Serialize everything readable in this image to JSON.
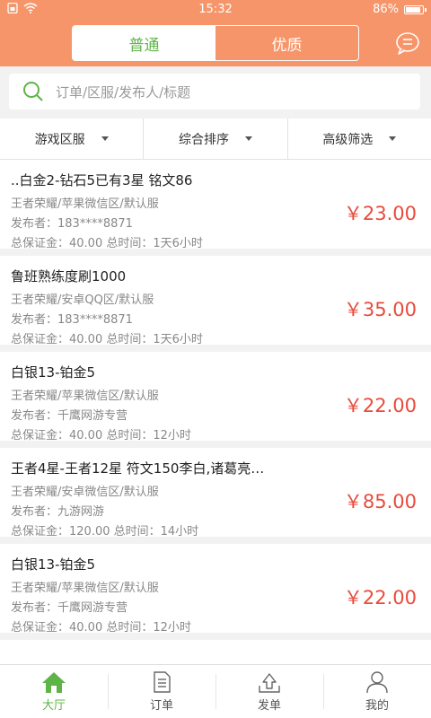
{
  "status": {
    "time": "15:32",
    "battery": "86%"
  },
  "header": {
    "tabs": [
      {
        "label": "普通",
        "active": true
      },
      {
        "label": "优质",
        "active": false
      }
    ],
    "accent_color": "#f7956a",
    "active_color": "#5fb447"
  },
  "search": {
    "placeholder": "订单/区服/发布人/标题"
  },
  "filters": [
    {
      "label": "游戏区服"
    },
    {
      "label": "综合排序"
    },
    {
      "label": "高级筛选"
    }
  ],
  "orders": [
    {
      "title": "..白金2-钻石5已有3星 铭文86",
      "region": "王者荣耀/苹果微信区/默认服",
      "publisher": "发布者：183****8871",
      "deposit": "总保证金：40.00 总时间：1天6小时",
      "price": "￥23.00"
    },
    {
      "title": "鲁班熟练度刷1000",
      "region": "王者荣耀/安卓QQ区/默认服",
      "publisher": "发布者：183****8871",
      "deposit": "总保证金：40.00 总时间：1天6小时",
      "price": "￥35.00"
    },
    {
      "title": "白银13-铂金5",
      "region": "王者荣耀/苹果微信区/默认服",
      "publisher": "发布者：千鹰网游专营",
      "deposit": "总保证金：40.00 总时间：12小时",
      "price": "￥22.00"
    },
    {
      "title": "王者4星-王者12星 符文150李白,诸葛亮…",
      "region": "王者荣耀/安卓微信区/默认服",
      "publisher": "发布者：九游网游",
      "deposit": "总保证金：120.00 总时间：14小时",
      "price": "￥85.00"
    },
    {
      "title": "白银13-铂金5",
      "region": "王者荣耀/苹果微信区/默认服",
      "publisher": "发布者：千鹰网游专营",
      "deposit": "总保证金：40.00 总时间：12小时",
      "price": "￥22.00"
    }
  ],
  "tabbar": [
    {
      "label": "大厅",
      "icon": "home-icon",
      "active": true
    },
    {
      "label": "订单",
      "icon": "order-icon",
      "active": false
    },
    {
      "label": "发单",
      "icon": "publish-icon",
      "active": false
    },
    {
      "label": "我的",
      "icon": "user-icon",
      "active": false
    }
  ]
}
